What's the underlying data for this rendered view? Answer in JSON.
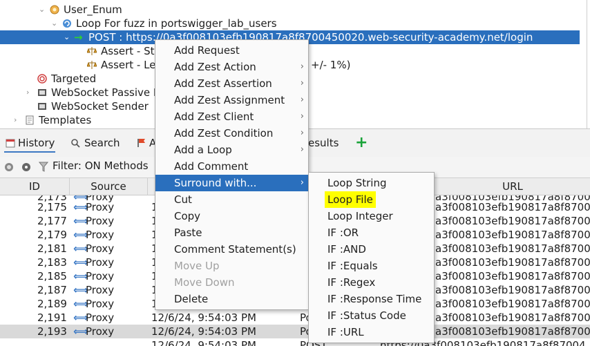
{
  "tree": {
    "items": [
      {
        "label": "User_Enum"
      },
      {
        "label": "Loop For fuzz in portswigger_lab_users"
      },
      {
        "label": "POST : https://0a3f008103efb190817a8f8700450020.web-security-academy.net/login"
      },
      {
        "label": "Assert - St"
      },
      {
        "label": "Assert - Le"
      },
      {
        "label": "Targeted"
      },
      {
        "label": "WebSocket Passive I"
      },
      {
        "label": "WebSocket Sender"
      },
      {
        "label": "Templates"
      }
    ],
    "assert_suffix": "+/- 1%)"
  },
  "tabs": {
    "history": "History",
    "search": "Search",
    "alerts_fragment": "A",
    "results_fragment": "esults"
  },
  "filter": {
    "label": "Filter: ON Methods"
  },
  "table": {
    "headers": {
      "id": "ID",
      "source": "Source",
      "url": "URL"
    },
    "rows": [
      {
        "id": "2,173",
        "source": "Proxy",
        "time": "",
        "method": "",
        "url": "a3f008103efb190817a8f8700"
      },
      {
        "id": "2,175",
        "source": "Proxy",
        "time": "1",
        "method": "",
        "url": "a3f008103efb190817a8f87004"
      },
      {
        "id": "2,177",
        "source": "Proxy",
        "time": "1",
        "method": "",
        "url": "a3f008103efb190817a8f87004"
      },
      {
        "id": "2,179",
        "source": "Proxy",
        "time": "1",
        "method": "",
        "url": "a3f008103efb190817a8f87004"
      },
      {
        "id": "2,181",
        "source": "Proxy",
        "time": "1",
        "method": "",
        "url": "a3f008103efb190817a8f87004"
      },
      {
        "id": "2,183",
        "source": "Proxy",
        "time": "1",
        "method": "",
        "url": "a3f008103efb190817a8f87004"
      },
      {
        "id": "2,185",
        "source": "Proxy",
        "time": "1",
        "method": "",
        "url": "a3f008103efb190817a8f87004"
      },
      {
        "id": "2,187",
        "source": "Proxy",
        "time": "1",
        "method": "",
        "url": "a3f008103efb190817a8f87004"
      },
      {
        "id": "2,189",
        "source": "Proxy",
        "time": "1",
        "method": "",
        "url": "a3f008103efb190817a8f87004"
      },
      {
        "id": "2,191",
        "source": "Proxy",
        "time": "12/6/24, 9:54:03 PM",
        "method": "Po",
        "url": "a3f008103efb190817a8f87004"
      },
      {
        "id": "2,193",
        "source": "Proxy",
        "time": "12/6/24, 9:54:03 PM",
        "method": "Po",
        "url": "a3f008103efb190817a8f87004"
      },
      {
        "id": "",
        "source": "",
        "time": "12/6/24, 9:54:03 PM",
        "method": "POST",
        "url": "https://0a3f008103efb190817a8f87004"
      }
    ]
  },
  "context_menu": {
    "items": [
      {
        "label": "Add Request",
        "submenu": false
      },
      {
        "label": "Add Zest Action",
        "submenu": true
      },
      {
        "label": "Add Zest Assertion",
        "submenu": true
      },
      {
        "label": "Add Zest Assignment",
        "submenu": true
      },
      {
        "label": "Add Zest Client",
        "submenu": true
      },
      {
        "label": "Add Zest Condition",
        "submenu": true
      },
      {
        "label": "Add a Loop",
        "submenu": true
      },
      {
        "label": "Add Comment",
        "submenu": false
      },
      {
        "label": "Surround with...",
        "submenu": true
      },
      {
        "label": "Cut",
        "submenu": false
      },
      {
        "label": "Copy",
        "submenu": false
      },
      {
        "label": "Paste",
        "submenu": false
      },
      {
        "label": "Comment Statement(s)",
        "submenu": false
      },
      {
        "label": "Move Up",
        "submenu": false
      },
      {
        "label": "Move Down",
        "submenu": false
      },
      {
        "label": "Delete",
        "submenu": false
      }
    ],
    "arrow_glyph": "›"
  },
  "submenu": {
    "items": [
      {
        "label": "Loop String"
      },
      {
        "label": "Loop File"
      },
      {
        "label": "Loop Integer"
      },
      {
        "label": "IF :OR"
      },
      {
        "label": "IF :AND"
      },
      {
        "label": "IF :Equals"
      },
      {
        "label": "IF :Regex"
      },
      {
        "label": "IF :Response Time"
      },
      {
        "label": "IF :Status Code"
      },
      {
        "label": "IF :URL"
      }
    ]
  },
  "colors": {
    "selection": "#2a6fbd",
    "highlight": "#ffff00",
    "add_green": "#1aa33a",
    "proxy_arrow": "#3a78c5"
  }
}
